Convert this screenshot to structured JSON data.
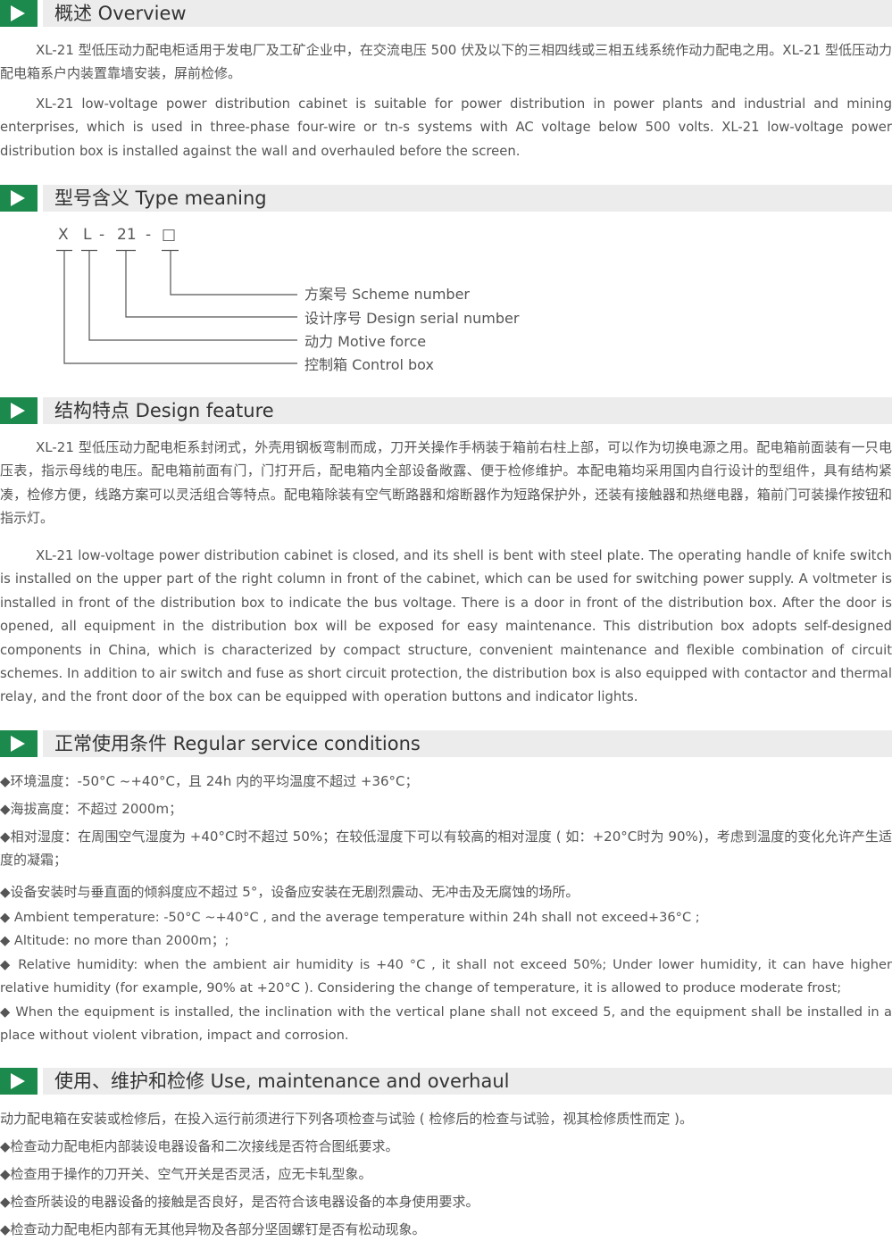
{
  "colors": {
    "accent": "#1b8a4c",
    "header_bar": "#ececec",
    "text": "#555555"
  },
  "sections": {
    "overview": {
      "title": "概述 Overview",
      "p1": "XL-21 型低压动力配电柜适用于发电厂及工矿企业中，在交流电压 500 伏及以下的三相四线或三相五线系统作动力配电之用。XL-21 型低压动力配电箱系户内装置靠墙安装，屏前检修。",
      "p2": "XL-21 low-voltage power distribution cabinet is suitable for power distribution in power plants and industrial and mining enterprises, which is used in three-phase four-wire or tn-s systems with AC voltage below 500 volts. XL-21 low-voltage power distribution box is installed against the wall and overhauled before the screen."
    },
    "type_meaning": {
      "title": "型号含义 Type meaning",
      "code": {
        "c1": "X",
        "c2": "L",
        "d1": "-",
        "c3": "21",
        "d2": "-",
        "c4": "□"
      },
      "labels": [
        "方案号 Scheme number",
        "设计序号 Design serial number",
        "动力 Motive force",
        "控制箱 Control box"
      ]
    },
    "design_feature": {
      "title": "结构特点 Design feature",
      "p1": "XL-21 型低压动力配电柜系封闭式，外壳用钢板弯制而成，刀开关操作手柄装于箱前右柱上部，可以作为切换电源之用。配电箱前面装有一只电压表，指示母线的电压。配电箱前面有门，门打开后，配电箱内全部设备敞露、便于检修维护。本配电箱均采用国内自行设计的型组件，具有结构紧凑，检修方便，线路方案可以灵活组合等特点。配电箱除装有空气断路器和熔断器作为短路保护外，还装有接触器和热继电器，箱前门可装操作按钮和指示灯。",
      "p2": "XL-21 low-voltage power distribution cabinet is closed, and its shell is bent with steel plate. The operating handle of knife switch is installed on the upper part of the right column in front of the cabinet, which can be used for switching power supply. A voltmeter is installed in front of the distribution box to indicate the bus voltage. There is a door in front of the distribution box. After the door is opened, all equipment in the distribution box will be exposed for easy maintenance. This distribution box adopts self-designed components in China, which is characterized by compact structure, convenient maintenance and flexible combination of circuit schemes. In addition to air switch and fuse as short circuit protection, the distribution box is also equipped with contactor and thermal relay, and the front door of the box can be equipped with operation buttons and indicator lights."
    },
    "service_conditions": {
      "title": "正常使用条件 Regular service conditions",
      "items_cn": [
        "◆环境温度：-50°C ~+40°C，且 24h 内的平均温度不超过 +36°C；",
        "◆海拔高度：不超过 2000m；",
        "◆相对湿度：在周围空气湿度为 +40°C时不超过 50%；在较低湿度下可以有较高的相对湿度 ( 如：+20°C时为 90%)，考虑到温度的变化允许产生适度的凝霜；",
        "◆设备安装时与垂直面的倾斜度应不超过 5°，设备应安装在无剧烈震动、无冲击及无腐蚀的场所。"
      ],
      "items_en": [
        "◆ Ambient temperature: -50°C ~+40°C , and the average temperature within 24h shall not exceed+36°C ;",
        "◆ Altitude: no more than 2000m；;",
        "◆ Relative humidity: when the ambient air humidity is +40 °C , it shall not exceed 50%; Under lower humidity, it can have higher relative humidity (for example, 90% at +20°C ). Considering the change of temperature, it is allowed to produce moderate frost;",
        "◆ When the equipment is installed, the inclination with the vertical plane shall not exceed 5, and the equipment shall be installed in a place without violent vibration, impact and corrosion."
      ]
    },
    "maintenance": {
      "title": "使用、维护和检修 Use, maintenance and overhaul",
      "intro": "动力配电箱在安装或检修后，在投入运行前须进行下列各项检查与试验 ( 检修后的检查与试验，视其检修质性而定 )。",
      "items": [
        "◆检查动力配电柜内部装设电器设备和二次接线是否符合图纸要求。",
        "◆检查用于操作的刀开关、空气开关是否灵活，应无卡轧型象。",
        "◆检查所装设的电器设备的接触是否良好，是否符合该电器设备的本身使用要求。",
        "◆检查动力配电柜内部有无其他异物及各部分坚固螺钉是否有松动现象。"
      ]
    }
  }
}
